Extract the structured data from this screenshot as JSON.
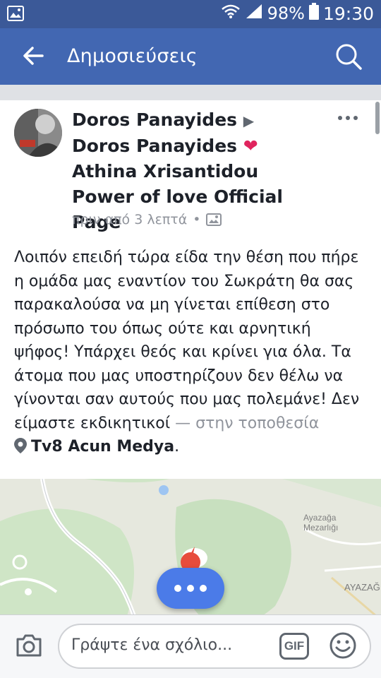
{
  "status_bar": {
    "battery": "98%",
    "time": "19:30"
  },
  "app_bar": {
    "title": "Δημοσιεύσεις"
  },
  "post": {
    "author_line": {
      "name": "Doros Panayides",
      "arrow": "▶",
      "target_name": "Doros Panayides",
      "heart": "❤",
      "page_name": "Athina Xrisantidou Power of love Official Page"
    },
    "time": "πριν από 3 λεπτά",
    "separator": "•",
    "body": "Λοιπόν επειδή τώρα είδα την θέση που πήρε η ομάδα μας εναντίον του Σωκράτη θα σας παρακαλούσα να μη γίνεται επίθεση στο πρόσωπο του όπως ούτε και αρνητική ψήφος! Υπάρχει θεός και κρίνει για όλα. Τα άτομα που μας υποστηρίζουν δεν θέλω να γίνονται σαν αυτούς που μας πολεμάνε! Δεν είμαστε εκδικητικοί",
    "location_prefix": "— στην τοποθεσία",
    "location_name": "Tv8 Acun Medya",
    "location_end": "."
  },
  "map": {
    "label_1": "Ayazağa",
    "label_2": "Mezarlığı",
    "label_3": "AYAZAĞ"
  },
  "composer": {
    "placeholder": "Γράψτε ένα σχόλιο...",
    "gif_label": "GIF"
  },
  "icons": [
    "image-icon",
    "wifi-icon",
    "signal-icon",
    "battery-icon",
    "back-arrow-icon",
    "search-icon",
    "more-icon",
    "photo-icon",
    "location-pin-icon",
    "camera-icon",
    "gif-icon",
    "emoji-icon"
  ],
  "colors": {
    "status_bar": "#3b5998",
    "app_bar": "#4267b2",
    "heart": "#e0245e",
    "fab": "#4b7be8"
  }
}
